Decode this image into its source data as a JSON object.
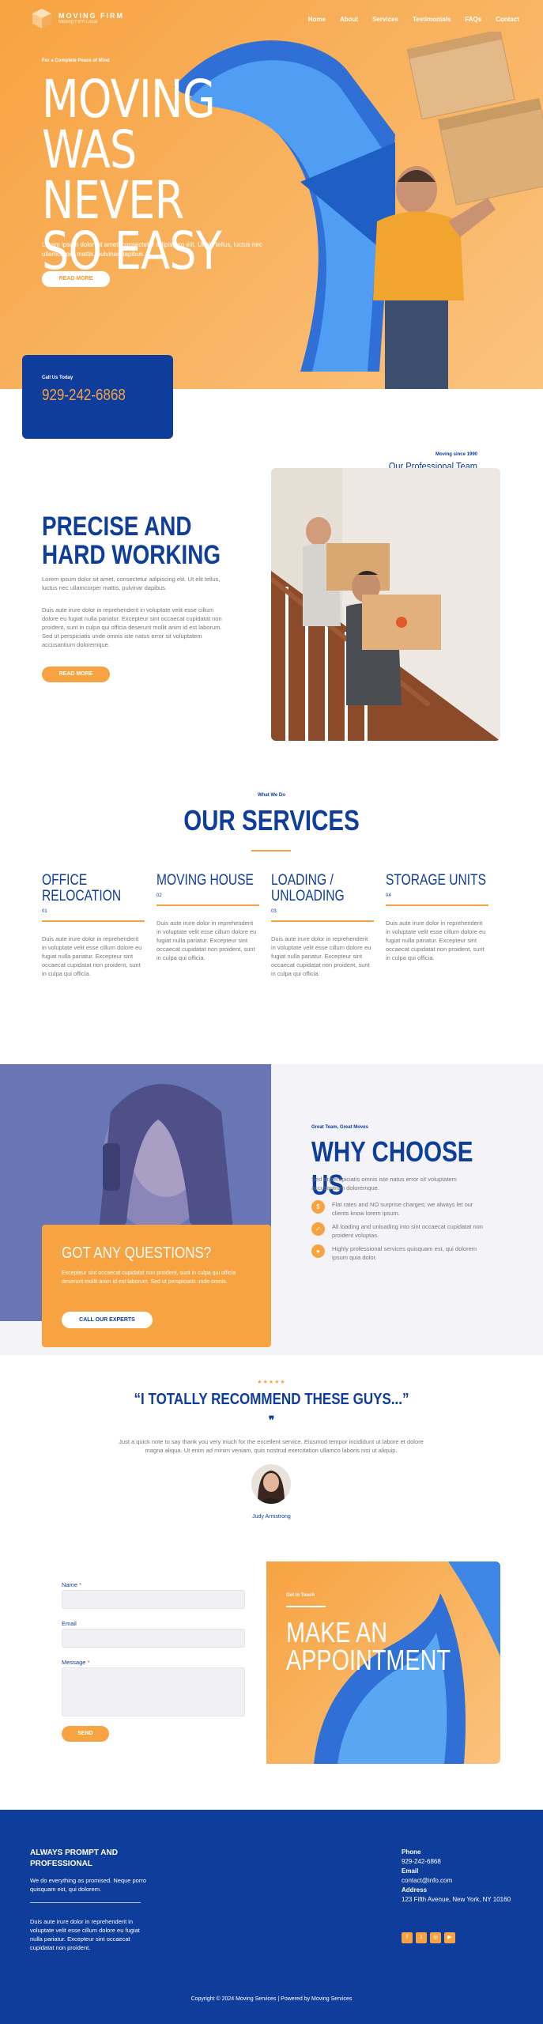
{
  "brand": {
    "name": "MOVING FIRM",
    "tagline": "Moving Firm Local"
  },
  "nav": [
    "Home",
    "About",
    "Services",
    "Testimonials",
    "FAQs",
    "Contact"
  ],
  "hero": {
    "eyebrow": "For a Complete Peace of Mind",
    "title": "MOVING\nWAS NEVER\nSO EASY",
    "desc": "Lorem ipsum dolor sit amet, consectetur adipiscing elit. Ut elit tellus, luctus nec ullamcorper mattis, pulvinar dapibus.",
    "button": "READ MORE"
  },
  "call": {
    "label": "Call Us Today",
    "phone": "929-242-6868"
  },
  "about": {
    "since": "Moving since 1990",
    "team": "Our Professional Team Makes Packing and Moving a Nice Experience.",
    "title": "PRECISE AND\nHARD WORKING",
    "p1": "Lorem ipsum dolor sit amet, consectetur adipiscing elit. Ut elit tellus, luctus nec ullamcorper mattis, pulvinar dapibus.",
    "p2": "Duis aute irure dolor in reprehenderit in voluptate velit esse cillum dolore eu fugiat nulla pariatur. Excepteur sint occaecat cupidatat non proident, sunt in culpa qui officia deserunt mollit anim id est laborum. Sed ut perspiciatis unde omnis iste natus error sit voluptatem accusantium doloremque.",
    "button": "READ MORE"
  },
  "services": {
    "eyebrow": "What We Do",
    "title": "OUR SERVICES",
    "items": [
      {
        "title": "OFFICE\nRELOCATION",
        "num": "01",
        "desc": "Duis aute irure dolor in reprehenderit in voluptate velit esse cillum dolore eu fugiat nulla pariatur. Excepteur sint occaecat cupidatat non proident, sunt in culpa qui officia."
      },
      {
        "title": "MOVING HOUSE",
        "num": "02",
        "desc": "Duis aute irure dolor in reprehenderit in voluptate velit esse cillum dolore eu fugiat nulla pariatur. Excepteur sint occaecat cupidatat non proident, sunt in culpa qui officia."
      },
      {
        "title": "LOADING /\nUNLOADING",
        "num": "03",
        "desc": "Duis aute irure dolor in reprehenderit in voluptate velit esse cillum dolore eu fugiat nulla pariatur. Excepteur sint occaecat cupidatat non proident, sunt in culpa qui officia."
      },
      {
        "title": "STORAGE UNITS",
        "num": "04",
        "desc": "Duis aute irure dolor in reprehenderit in voluptate velit esse cillum dolore eu fugiat nulla pariatur. Excepteur sint occaecat cupidatat non proident, sunt in culpa qui officia."
      }
    ]
  },
  "questions": {
    "title": "GOT ANY QUESTIONS?",
    "desc": "Excepteur sint occaecat cupidatat non proident, sunt in culpa qui officia deserunt mollit anim id est laborum. Sed ut perspiciatis unde omnis.",
    "button": "CALL OUR EXPERTS"
  },
  "why": {
    "eyebrow": "Great Team, Great Moves",
    "title": "WHY CHOOSE US",
    "desc": "Sed ut perspiciatis omnis iste natus error sit voluptatem accusantium doloremque.",
    "items": [
      {
        "icon": "dollar-icon",
        "text": "Flat rates and NO surprise charges; we always let our clients know lorem ipsum."
      },
      {
        "icon": "check-icon",
        "text": "All loading and unloading into sint occaecat cupidatat non proident voluptas."
      },
      {
        "icon": "user-icon",
        "text": "Highly professional services quisquam est, qui dolorem ipsum quia dolor."
      }
    ]
  },
  "testimonial": {
    "stars": "★★★★★",
    "title": "“I TOTALLY RECOMMEND THESE GUYS...”",
    "quote_mark": "❞",
    "text": "Just a quick note to say thank you very much for the excellent service. Eiusmod tempor incididunt ut labore et dolore magna aliqua. Ut enim ad minim veniam, quis nostrud exercitation ullamco laboris nisi ut aliquip.",
    "name": "Judy Armstrong"
  },
  "form": {
    "name_label": "Name",
    "email_label": "Email",
    "message_label": "Message",
    "required_mark": "*",
    "send": "SEND"
  },
  "appointment": {
    "eyebrow": "Get In Touch",
    "title": "MAKE AN\nAPPOINTMENT"
  },
  "footer": {
    "title": "ALWAYS PROMPT AND PROFESSIONAL",
    "desc": "We do everything as promised. Neque porro quisquam est, qui dolorem.",
    "desc2": "Duis aute irure dolor in reprehenderit in voluptate velit esse cillum dolore eu fugiat nulla pariatur. Excepteur sint occaecat cupidatat non proident.",
    "phone_label": "Phone",
    "phone": "929-242-6868",
    "email_label": "Email",
    "email": "contact@info.com",
    "address_label": "Address",
    "address": "123 Fifth Avenue, New York, NY 10160",
    "copyright": "Copyright © 2024 Moving Services | Powered by Moving Services"
  },
  "colors": {
    "orange": "#f7a341",
    "navy": "#0f3d9b",
    "light": "#f4f4f8"
  }
}
